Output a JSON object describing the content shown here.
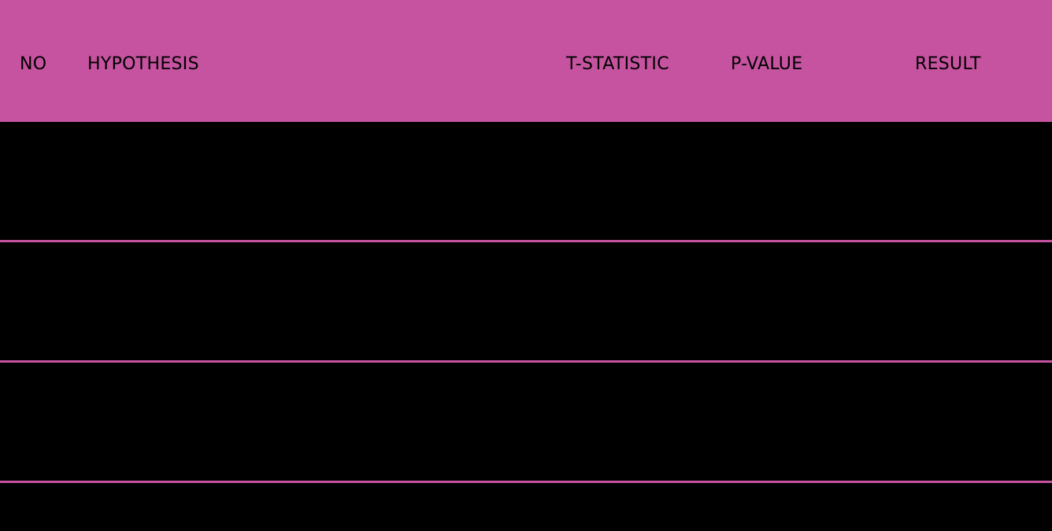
{
  "table": {
    "columns": {
      "no": "NO",
      "hypothesis": "HYPOTHESIS",
      "t_statistic": "T-STATISTIC",
      "p_value": "P-VALUE",
      "result": "RESULT"
    }
  },
  "colors": {
    "header_background": "#c5539f",
    "row_background": "#000000",
    "divider": "#c5539f"
  }
}
